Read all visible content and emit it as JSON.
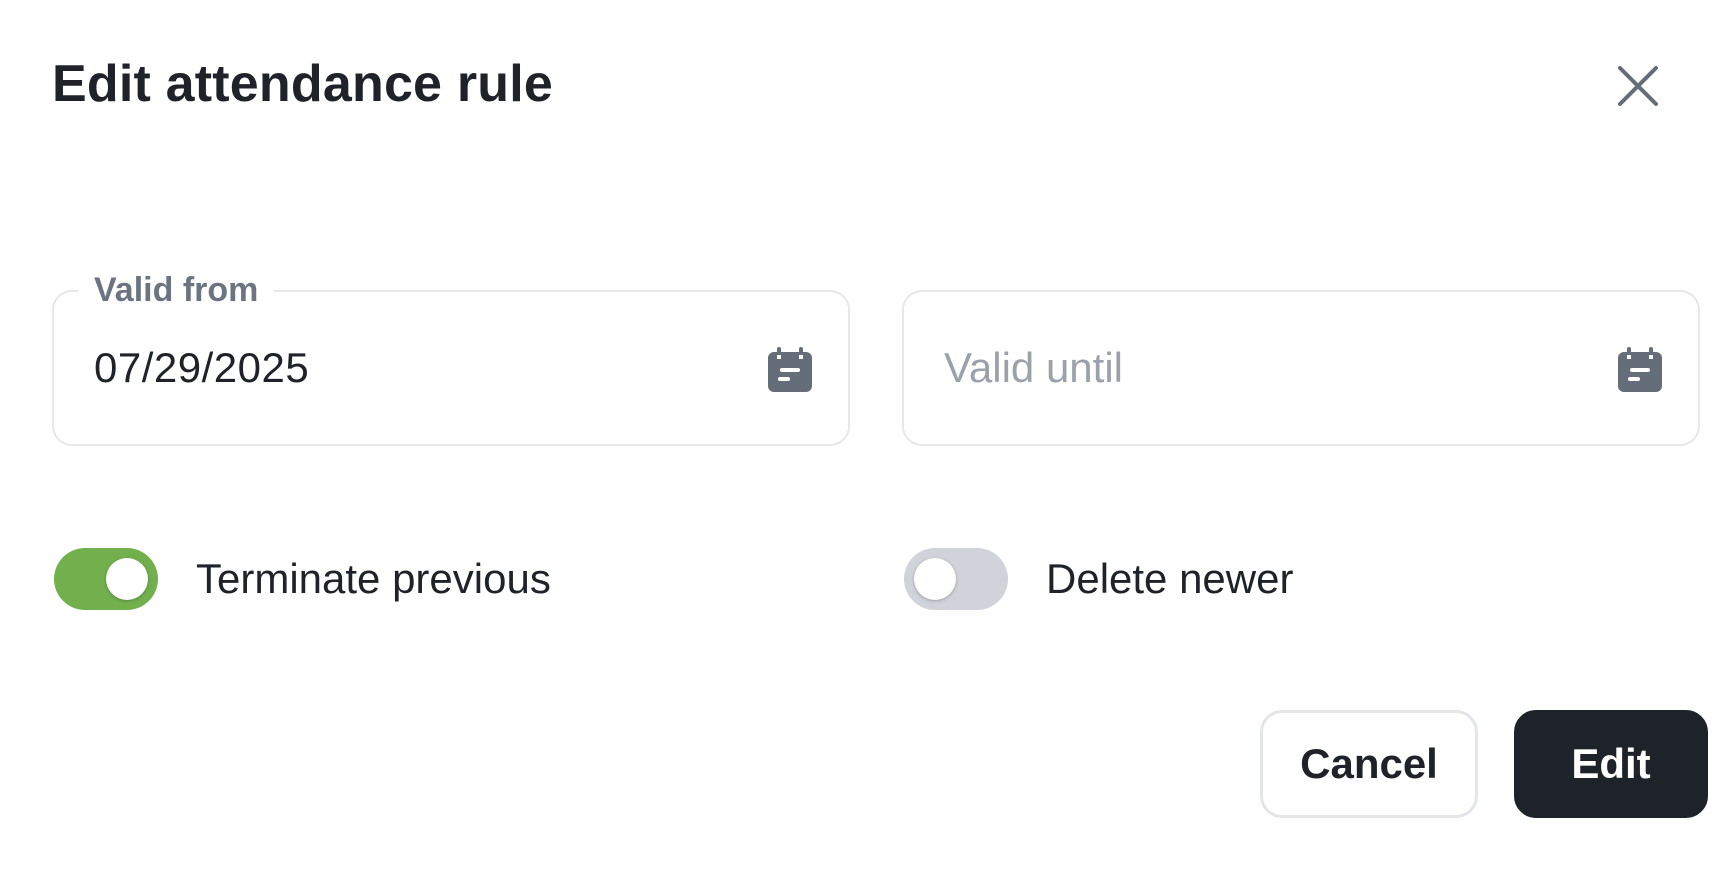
{
  "dialog": {
    "title": "Edit attendance rule"
  },
  "valid_from": {
    "label": "Valid from",
    "value": "07/29/2025",
    "icon": "calendar-icon"
  },
  "valid_until": {
    "placeholder": "Valid until",
    "value": "",
    "icon": "calendar-icon"
  },
  "toggles": {
    "terminate_previous": {
      "label": "Terminate previous",
      "checked": true
    },
    "delete_newer": {
      "label": "Delete newer",
      "checked": false
    }
  },
  "actions": {
    "cancel_label": "Cancel",
    "edit_label": "Edit"
  },
  "colors": {
    "toggle_on": "#72b04d",
    "toggle_off": "#d0d3d9",
    "primary_button": "#1e2329",
    "text": "#1f2329",
    "muted": "#6b7480",
    "icon": "#646d78"
  }
}
